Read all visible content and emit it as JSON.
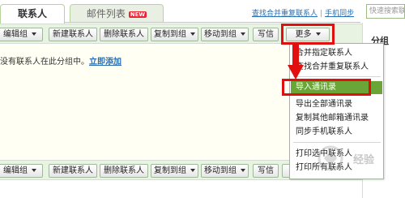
{
  "tabs": {
    "contacts": "联系人",
    "maillist": "邮件列表",
    "new_badge": "NEW"
  },
  "header": {
    "merge_link": "查找合并重复联系人",
    "separator": "|",
    "sync_link": "手机同步",
    "search_placeholder": "快速搜索联系"
  },
  "toolbar": {
    "edit_group": "编辑组",
    "new_contact": "新建联系人",
    "delete_contact": "删除联系人",
    "copy_to_group": "复制到组",
    "move_to_group": "移动到组",
    "write_letter": "写信",
    "more": "更多"
  },
  "content": {
    "empty_message": "没有联系人在此分组中。",
    "add_link": "立即添加"
  },
  "right_panel": {
    "title": "分组"
  },
  "more_menu": {
    "items": [
      "合并指定联系人",
      "查找合并重复联系人",
      "导入通讯录",
      "导出全部通讯录",
      "复制其他邮箱通讯录",
      "同步手机联系人",
      "打印选中联系人",
      "打印所有联系人"
    ],
    "highlighted_index": 2
  },
  "colors": {
    "accent_green": "#6aa637",
    "annotation_red": "#e01010",
    "toolbar_bg": "#e8f3e1"
  },
  "watermark": {
    "text": "经验"
  }
}
